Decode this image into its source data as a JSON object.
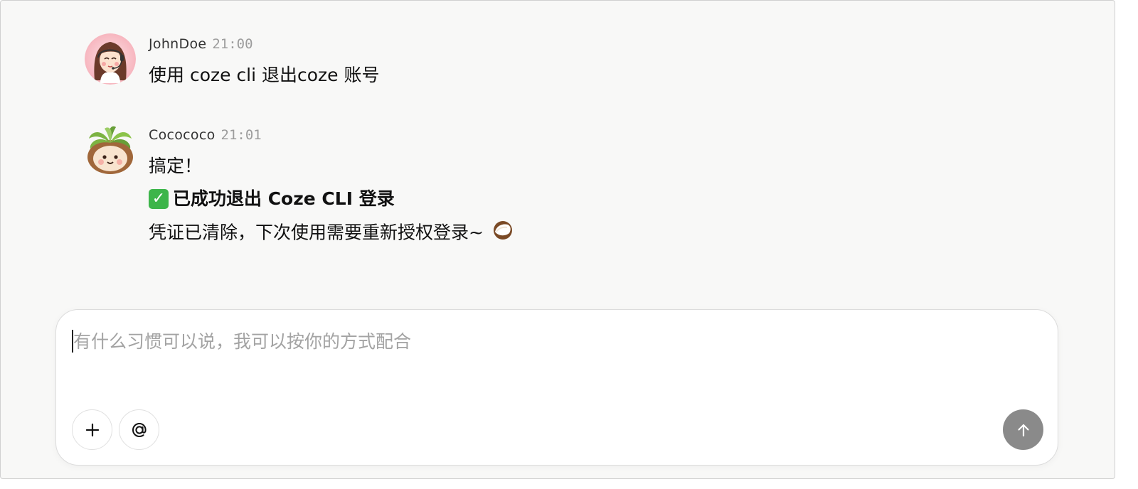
{
  "messages": [
    {
      "author": "JohnDoe",
      "time": "21:00",
      "avatar_icon": "woman-with-headset-avatar",
      "lines": [
        "使用 coze cli 退出coze 账号"
      ]
    },
    {
      "author": "Cocococo",
      "time": "21:01",
      "avatar_icon": "coconut-with-leaves-avatar",
      "line_1": "搞定！",
      "status_icon": "check-mark-emoji",
      "status_text": "已成功退出 Coze CLI 登录",
      "line_3": "凭证已清除，下次使用需要重新授权登录~",
      "trailing_emoji": "coconut-emoji"
    }
  ],
  "composer": {
    "placeholder": "有什么习惯可以说，我可以按你的方式配合",
    "value": "",
    "add_icon": "plus-icon",
    "mention_icon": "at-sign-icon",
    "send_icon": "arrow-up-icon"
  },
  "colors": {
    "background": "#f8f8f7",
    "check_green": "#3db54a",
    "send_button": "#8a8a8a"
  }
}
